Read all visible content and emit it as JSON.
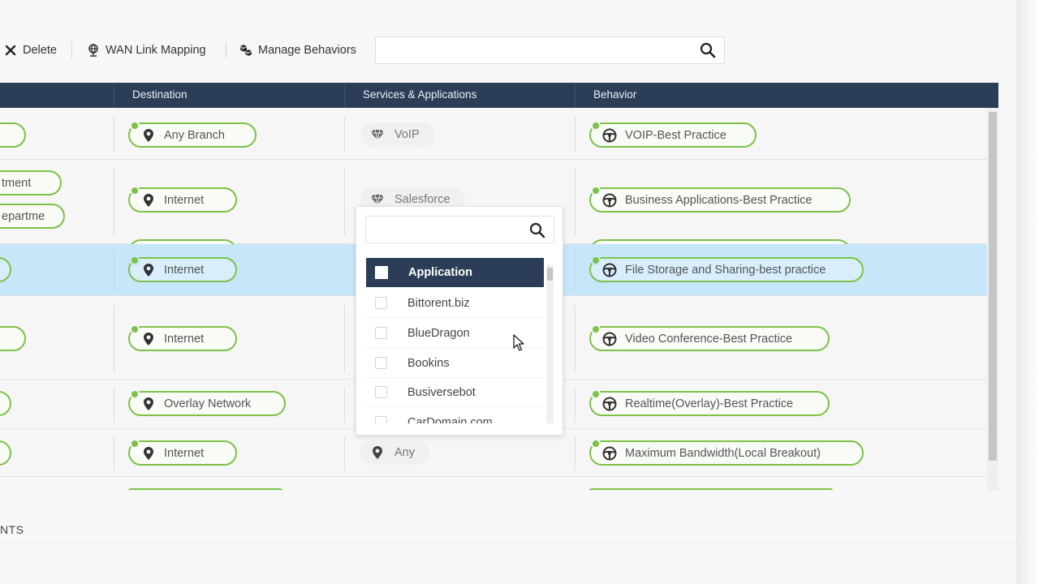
{
  "toolbar": {
    "delete_label": "Delete",
    "wan_link_mapping_label": "WAN Link Mapping",
    "manage_behaviors_label": "Manage Behaviors",
    "search_value": "",
    "search_placeholder": ""
  },
  "table": {
    "columns": [
      "Destination",
      "Services & Applications",
      "Behavior"
    ],
    "rows": [
      {
        "source": "",
        "destination": "Any Branch",
        "service": "VoIP",
        "service_icon": "diamond-icon",
        "behavior": "VOIP-Best Practice"
      },
      {
        "source_lines": [
          "tment",
          "epartme"
        ],
        "destination": "Internet",
        "service": "Salesforce",
        "service_icon": "diamond-icon",
        "behavior": "Business Applications-Best Practice"
      },
      {
        "source": "",
        "destination": "Internet",
        "service": "",
        "behavior": "File Storage and Sharing-best practice",
        "selected": true
      },
      {
        "source": "",
        "destination": "Internet",
        "service": "",
        "behavior": "Video Conference-Best Practice"
      },
      {
        "source": "",
        "destination": "Overlay Network",
        "service": "",
        "behavior": "Realtime(Overlay)-Best Practice"
      },
      {
        "source": "",
        "destination": "Internet",
        "service": "Any",
        "service_icon": "location-pin-icon",
        "behavior": "Maximum Bandwidth(Local Breakout)"
      }
    ]
  },
  "dropdown": {
    "search_value": "",
    "header_label": "Application",
    "items": [
      "Bittorent.biz",
      "BlueDragon",
      "Bookins",
      "Busiversebot",
      "CarDomain.com"
    ]
  },
  "footer": {
    "label": "NTS"
  },
  "colors": {
    "header_bg": "#2c3e57",
    "pill_border": "#7cc247",
    "selected_row": "#c8e6fa"
  }
}
